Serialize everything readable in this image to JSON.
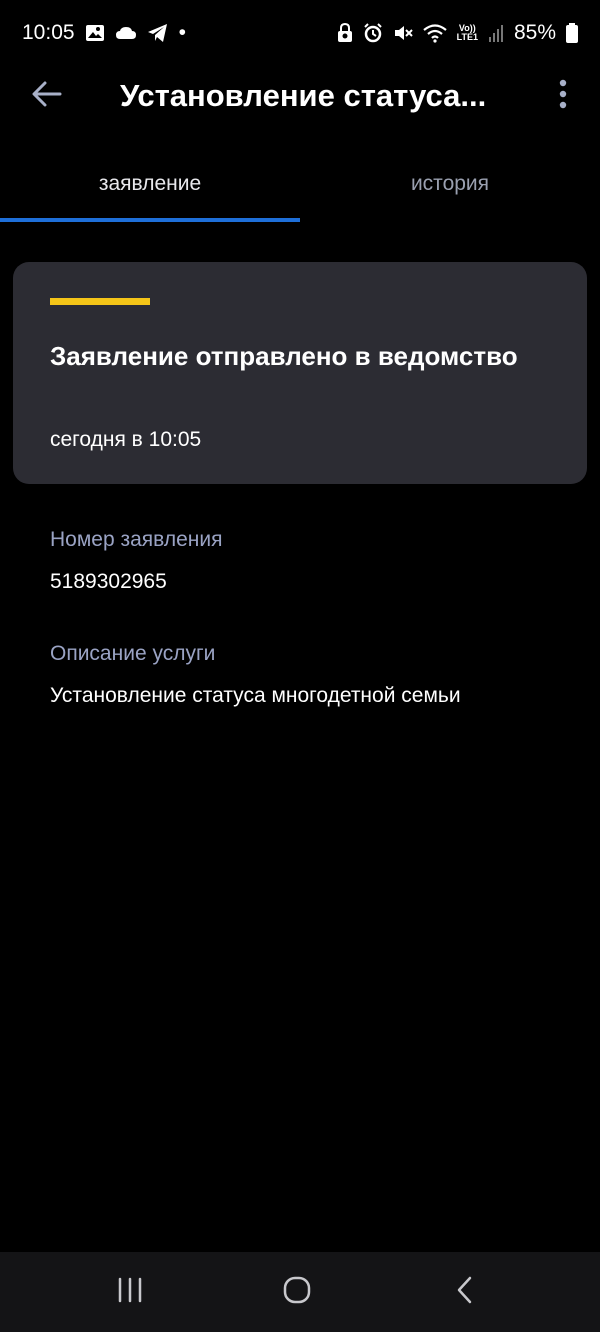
{
  "status_bar": {
    "time": "10:05",
    "battery": "85%",
    "lte_top": "Vo))",
    "lte_bottom": "LTE1",
    "dot": "•"
  },
  "app_bar": {
    "title": "Установление статуса..."
  },
  "tabs": [
    {
      "label": "заявление",
      "active": true
    },
    {
      "label": "история",
      "active": false
    }
  ],
  "status_card": {
    "title": "Заявление отправлено в ведомство",
    "date": "сегодня в 10:05",
    "accent_color": "#f5c518"
  },
  "details": {
    "number_label": "Номер заявления",
    "number_value": "5189302965",
    "service_label": "Описание услуги",
    "service_value": "Установление статуса многодетной семьи"
  },
  "icons": {
    "back": "arrow-left-icon",
    "more": "more-vertical-icon",
    "nav_recents": "recents-icon",
    "nav_home": "home-icon",
    "nav_back": "back-icon"
  }
}
